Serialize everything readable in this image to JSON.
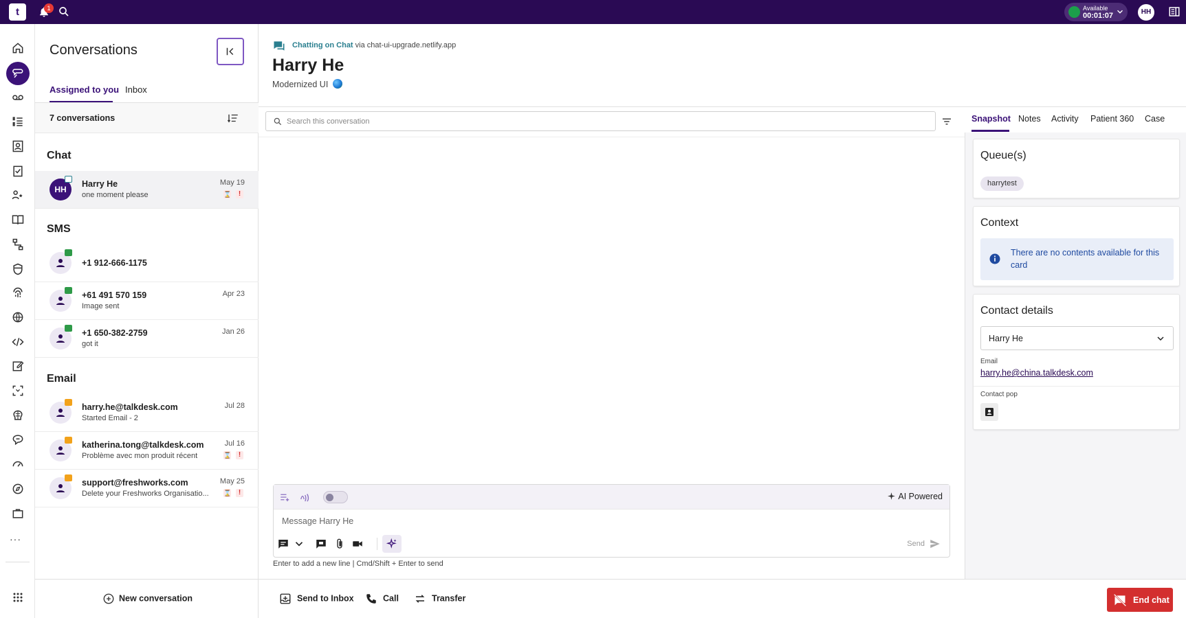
{
  "topbar": {
    "logo_text": "t",
    "notification_count": "1",
    "status_label": "Available",
    "status_time": "00:01:07",
    "user_initials": "HH"
  },
  "rail": {
    "more_label": "···",
    "items": [
      "home-icon",
      "conversations-icon",
      "voicemail-icon",
      "list-icon",
      "contacts-icon",
      "tasks-icon",
      "team-icon",
      "knowledge-icon",
      "flow-icon",
      "shield-icon",
      "fingerprint-icon",
      "globe-icon",
      "code-icon",
      "edit-icon",
      "capture-icon",
      "ai-icon",
      "feedback-icon",
      "dashboard-icon",
      "compass-icon",
      "briefcase-icon"
    ]
  },
  "conversations": {
    "title": "Conversations",
    "tabs": [
      {
        "label": "Assigned to you"
      },
      {
        "label": "Inbox"
      }
    ],
    "count_label": "7 conversations",
    "sections": {
      "chat": "Chat",
      "sms": "SMS",
      "email": "Email"
    },
    "items": [
      {
        "name": "Harry He",
        "preview": "one moment please",
        "date": "May 19",
        "initials": "HH"
      },
      {
        "name": "+1 912-666-1175",
        "preview": "",
        "date": ""
      },
      {
        "name": "+61 491 570 159",
        "preview": "Image sent",
        "date": "Apr 23"
      },
      {
        "name": "+1 650-382-2759",
        "preview": "got it",
        "date": "Jan 26"
      },
      {
        "name": "harry.he@talkdesk.com",
        "preview": "Started Email - 2",
        "date": "Jul 28"
      },
      {
        "name": "katherina.tong@talkdesk.com",
        "preview": "Problème avec mon produit récent",
        "date": "Jul 16"
      },
      {
        "name": "support@freshworks.com",
        "preview": "Delete your Freshworks Organisatio...",
        "date": "May 25"
      }
    ],
    "new_conversation_label": "New conversation"
  },
  "chat": {
    "channel_label": "Chatting on Chat",
    "channel_via": " via chat-ui-upgrade.netlify.app",
    "contact_name": "Harry He",
    "contact_sub": "Modernized UI",
    "search_placeholder": "Search this conversation",
    "composer": {
      "ai_powered_label": "AI Powered",
      "message_placeholder": "Message Harry He",
      "send_label": "Send",
      "hint": "Enter to add a new line | Cmd/Shift + Enter to send"
    }
  },
  "bottom_bar": {
    "send_to_inbox": "Send to Inbox",
    "call": "Call",
    "transfer": "Transfer",
    "end_chat": "End chat"
  },
  "right_panel": {
    "tabs": [
      "Snapshot",
      "Notes",
      "Activity",
      "Patient 360",
      "Case"
    ],
    "queues": {
      "title": "Queue(s)",
      "chip": "harrytest"
    },
    "context": {
      "title": "Context",
      "message": "There are no contents available for this card"
    },
    "contact_details": {
      "title": "Contact details",
      "selected_contact": "Harry He",
      "email_label": "Email",
      "email_value": "harry.he@china.talkdesk.com",
      "contact_pop_label": "Contact pop"
    }
  },
  "colors": {
    "brand": "#2a0a54",
    "accent": "#3b1278",
    "status_green": "#1c9f4b",
    "danger": "#d32f2f"
  }
}
